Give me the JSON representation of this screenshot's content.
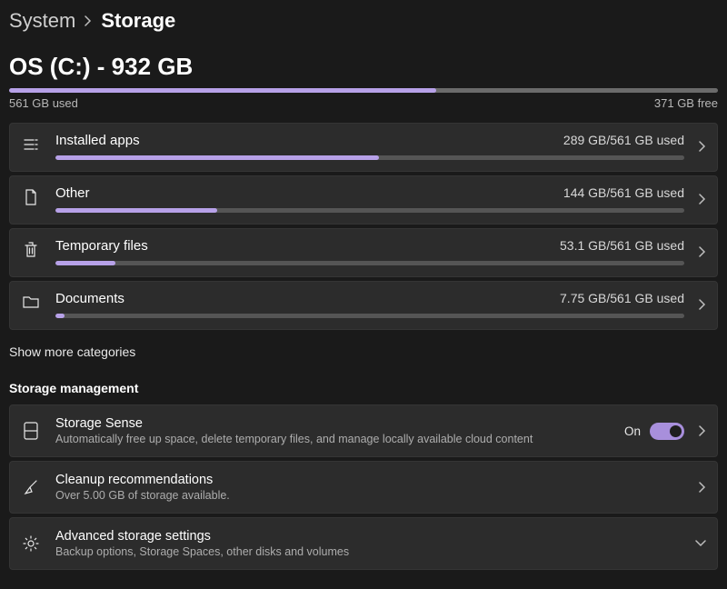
{
  "breadcrumb": {
    "parent": "System",
    "current": "Storage"
  },
  "drive": {
    "title": "OS (C:) - 932 GB",
    "used_label": "561 GB used",
    "free_label": "371 GB free",
    "fill_pct": 60.2
  },
  "categories": [
    {
      "name": "Installed apps",
      "used_label": "289 GB/561 GB used",
      "fill_pct": 51.5
    },
    {
      "name": "Other",
      "used_label": "144 GB/561 GB used",
      "fill_pct": 25.7
    },
    {
      "name": "Temporary files",
      "used_label": "53.1 GB/561 GB used",
      "fill_pct": 9.5
    },
    {
      "name": "Documents",
      "used_label": "7.75 GB/561 GB used",
      "fill_pct": 1.4
    }
  ],
  "show_more": "Show more categories",
  "management_title": "Storage management",
  "management": [
    {
      "title": "Storage Sense",
      "sub": "Automatically free up space, delete temporary files, and manage locally available cloud content",
      "toggle_state_label": "On",
      "chevron": "right"
    },
    {
      "title": "Cleanup recommendations",
      "sub": "Over 5.00 GB of storage available.",
      "chevron": "right"
    },
    {
      "title": "Advanced storage settings",
      "sub": "Backup options, Storage Spaces, other disks and volumes",
      "chevron": "down"
    }
  ]
}
